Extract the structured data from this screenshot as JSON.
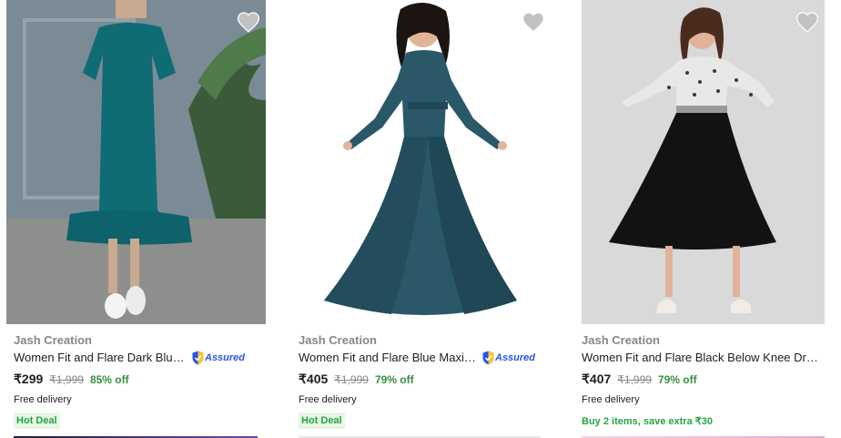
{
  "products": [
    {
      "brand": "Jash Creation",
      "title": "Women Fit and Flare Dark Blue Dress",
      "assured": "Assured",
      "price": "₹299",
      "mrp": "₹1,999",
      "discount": "85% off",
      "delivery": "Free delivery",
      "tag": "Hot Deal",
      "image": "model-teal-midi-dress",
      "dress_color": "#0f6b74"
    },
    {
      "brand": "Jash Creation",
      "title": "Women Fit and Flare Blue Maxi/Full Length Dress",
      "assured": "Assured",
      "price": "₹405",
      "mrp": "₹1,999",
      "discount": "79% off",
      "delivery": "Free delivery",
      "tag": "Hot Deal",
      "image": "model-blue-maxi-dress",
      "dress_color": "#2a5868"
    },
    {
      "brand": "Jash Creation",
      "title": "Women Fit and Flare Black Below Knee Dress",
      "price": "₹407",
      "mrp": "₹1,999",
      "discount": "79% off",
      "delivery": "Free delivery",
      "offer": "Buy 2 items, save extra ₹30",
      "image": "model-black-skirt-dress",
      "dress_color": "#121212"
    }
  ],
  "colors": {
    "assured_blue": "#2a55e5",
    "discount_green": "#388e3c",
    "deal_green": "#26a541",
    "wishlist_grey": "#c2c2c2"
  }
}
